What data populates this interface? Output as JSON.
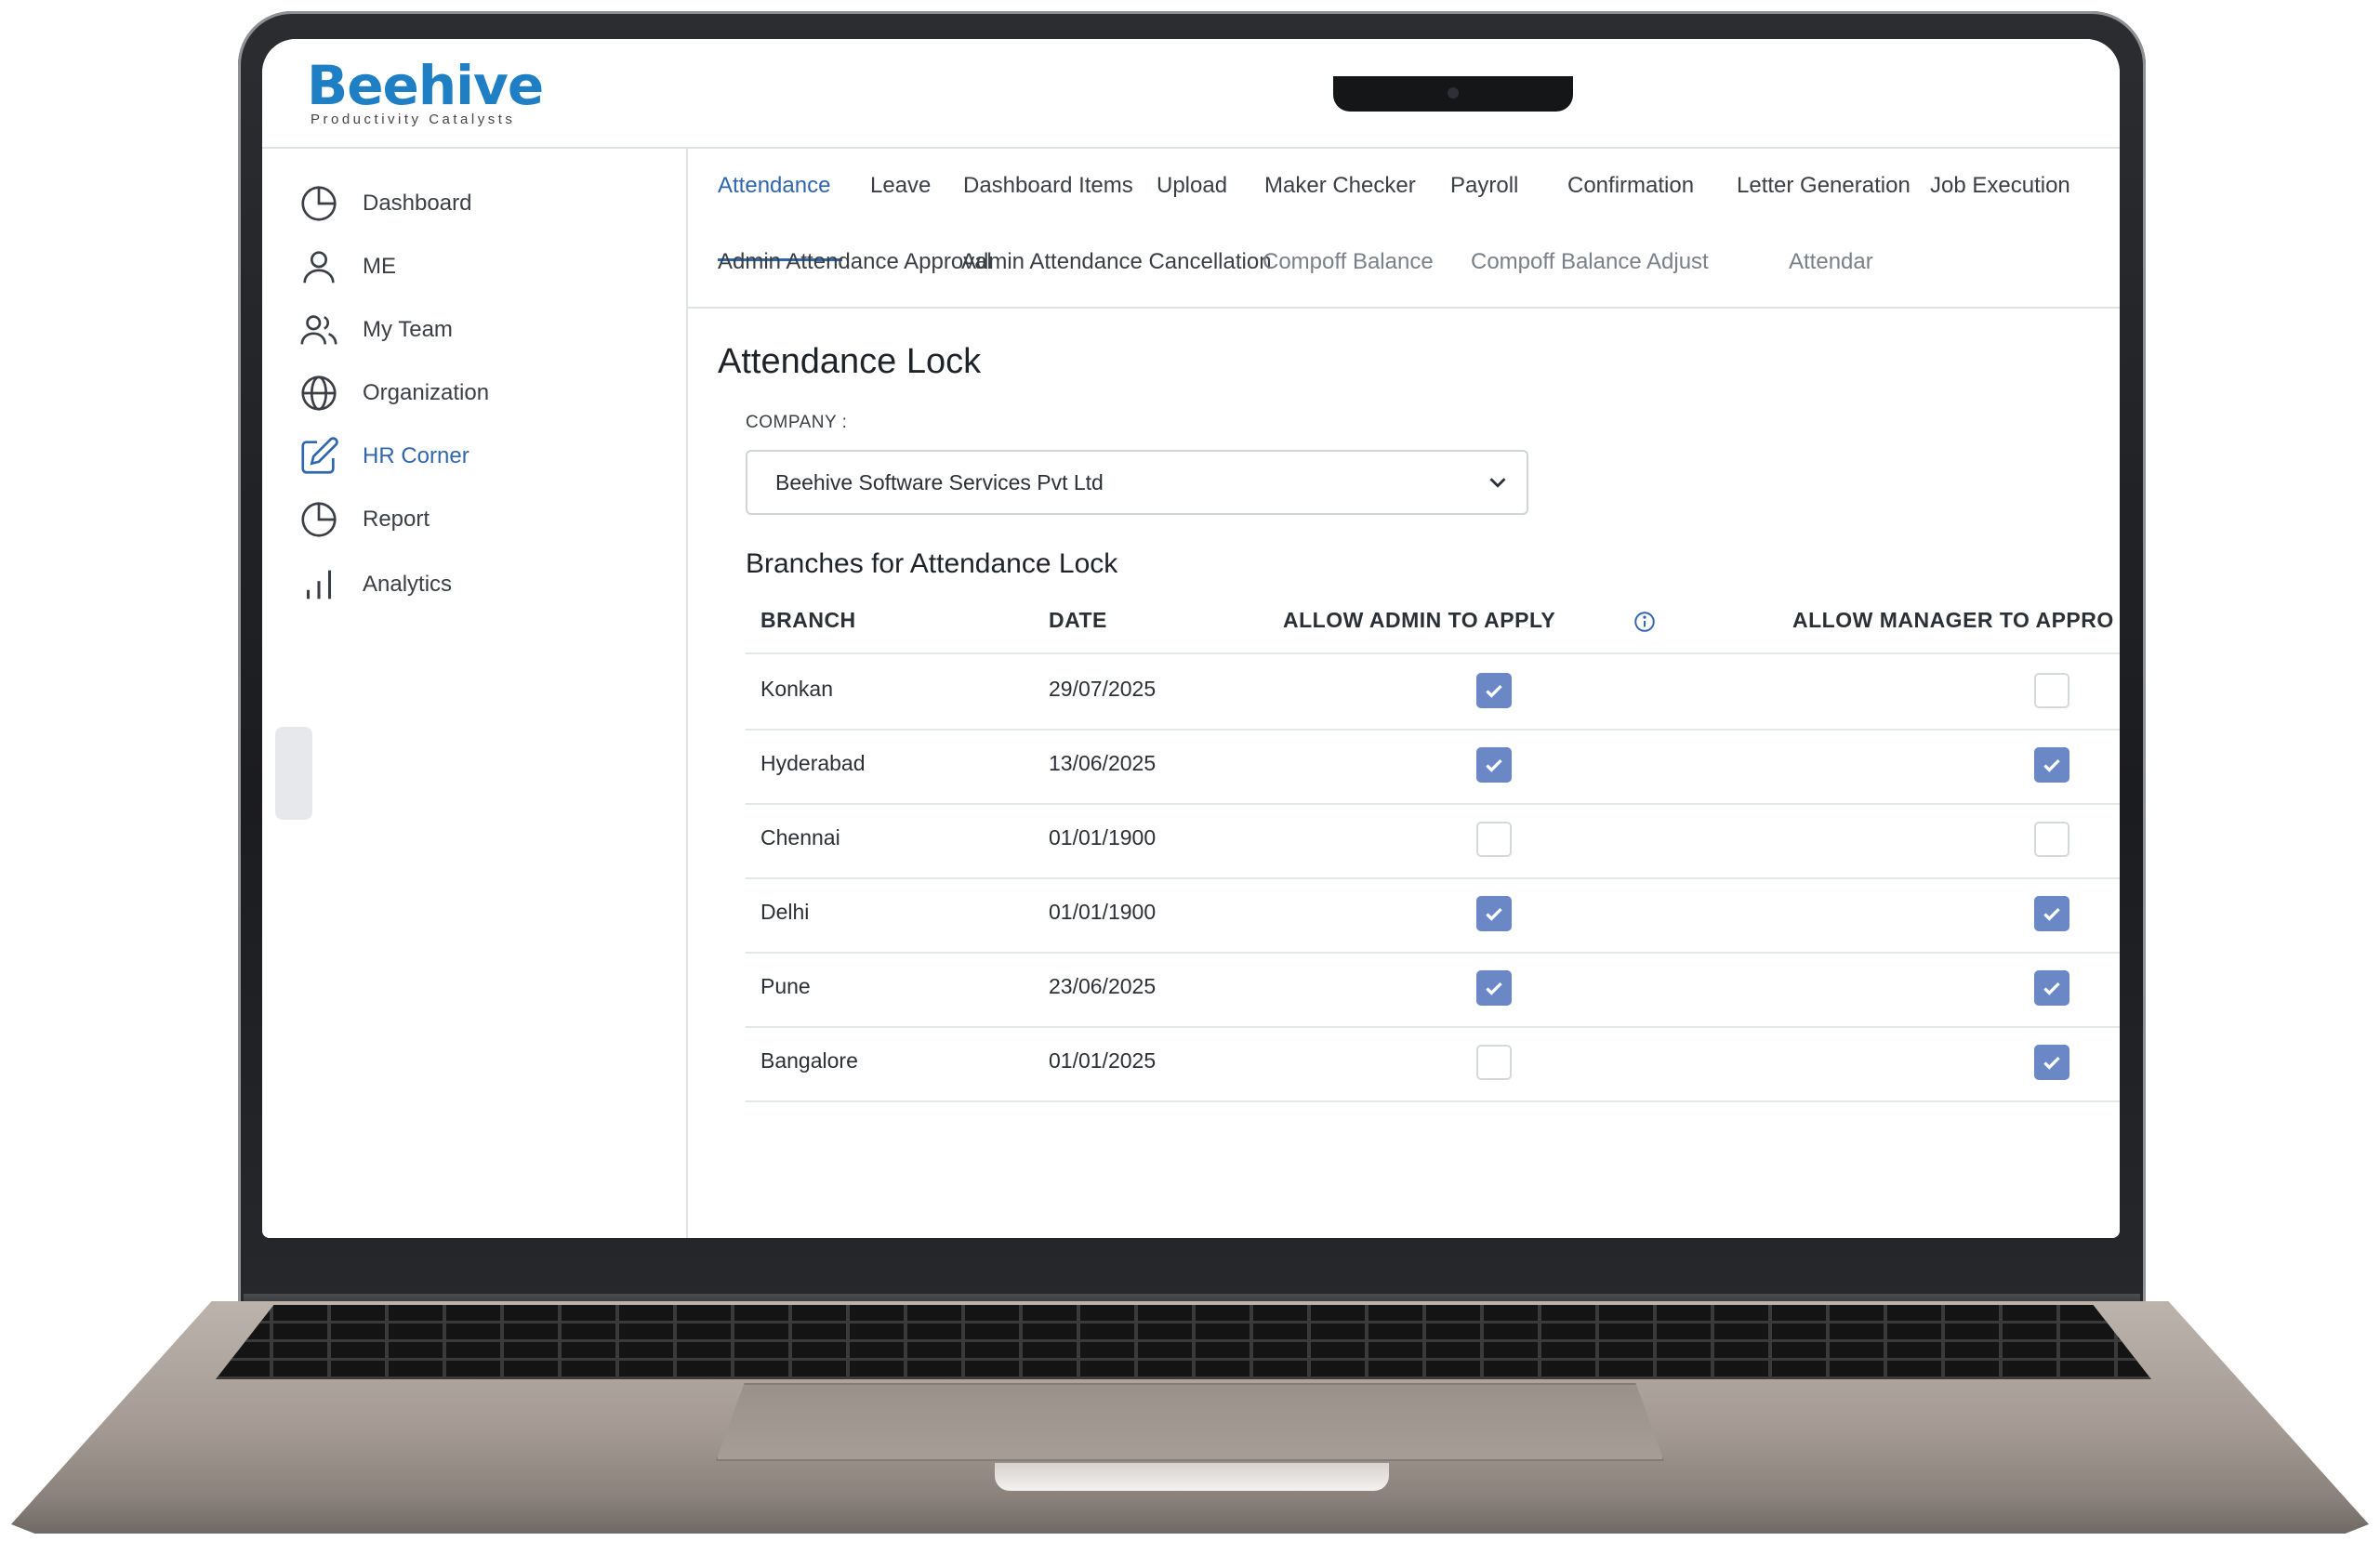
{
  "brand": {
    "name": "Beehive",
    "tagline": "Productivity Catalysts",
    "color": "#1f7fc4",
    "accent": "#f08a24"
  },
  "sidebar": {
    "items": [
      {
        "label": "Dashboard",
        "icon": "pie-chart-icon"
      },
      {
        "label": "ME",
        "icon": "user-icon"
      },
      {
        "label": "My Team",
        "icon": "users-icon"
      },
      {
        "label": "Organization",
        "icon": "globe-icon"
      },
      {
        "label": "HR Corner",
        "icon": "edit-icon",
        "active": true
      },
      {
        "label": "Report",
        "icon": "pie-chart-icon"
      },
      {
        "label": "Analytics",
        "icon": "bar-chart-icon"
      }
    ]
  },
  "tabs": [
    "Attendance",
    "Leave",
    "Dashboard Items",
    "Upload",
    "Maker Checker",
    "Payroll",
    "Confirmation",
    "Letter Generation",
    "Job Execution"
  ],
  "active_tab": "Attendance",
  "subtabs": [
    "Admin Attendance Approval",
    "Admin Attendance Cancellation",
    "Compoff Balance",
    "Compoff Balance Adjust",
    "Attendar"
  ],
  "page": {
    "title": "Attendance Lock",
    "company_label": "COMPANY :",
    "company_value": "Beehive Software Services Pvt Ltd",
    "section_title": "Branches for Attendance Lock"
  },
  "table": {
    "columns": [
      "BRANCH",
      "DATE",
      "ALLOW ADMIN TO APPLY",
      "ALLOW MANAGER TO APPRO"
    ],
    "rows": [
      {
        "branch": "Konkan",
        "date": "29/07/2025",
        "admin": true,
        "manager": false
      },
      {
        "branch": "Hyderabad",
        "date": "13/06/2025",
        "admin": true,
        "manager": true
      },
      {
        "branch": "Chennai",
        "date": "01/01/1900",
        "admin": false,
        "manager": false
      },
      {
        "branch": "Delhi",
        "date": "01/01/1900",
        "admin": true,
        "manager": true
      },
      {
        "branch": "Pune",
        "date": "23/06/2025",
        "admin": true,
        "manager": true
      },
      {
        "branch": "Bangalore",
        "date": "01/01/2025",
        "admin": false,
        "manager": true
      }
    ]
  },
  "colors": {
    "primary": "#2f66ad",
    "checkbox_checked": "#6b88c6"
  }
}
